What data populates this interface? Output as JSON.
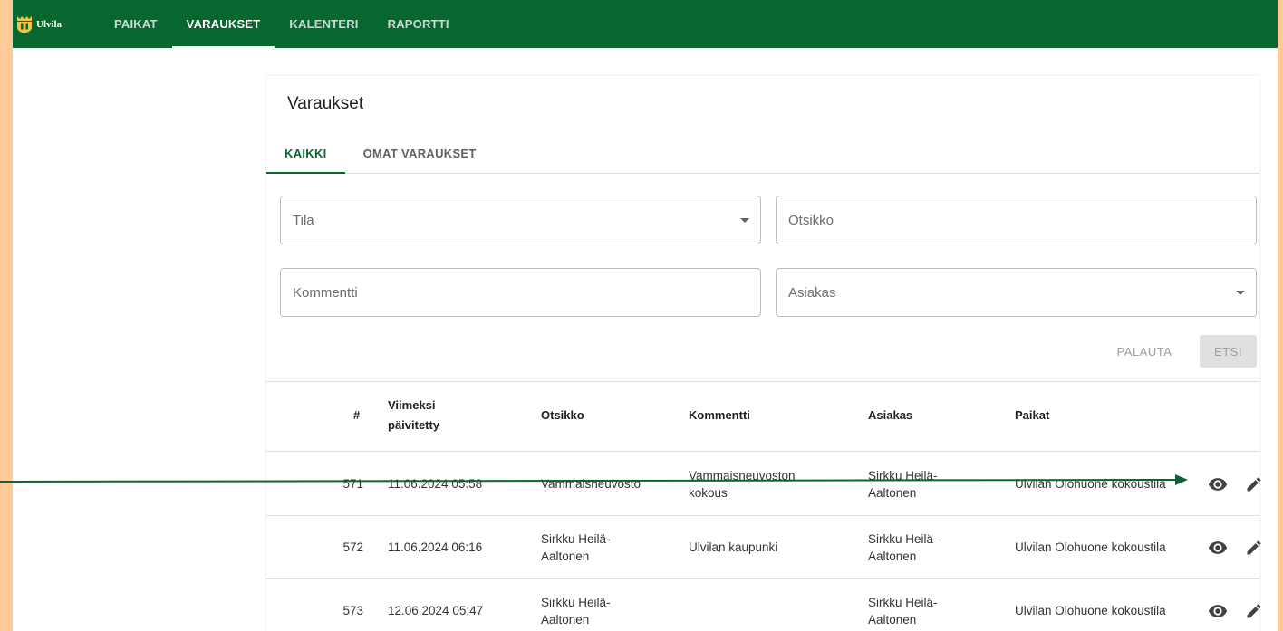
{
  "app": {
    "brand": "Ulvila"
  },
  "nav": [
    {
      "label": "PAIKAT",
      "active": false
    },
    {
      "label": "VARAUKSET",
      "active": true
    },
    {
      "label": "KALENTERI",
      "active": false
    },
    {
      "label": "RAPORTTI",
      "active": false
    }
  ],
  "page": {
    "title": "Varaukset"
  },
  "tabs": [
    {
      "label": "KAIKKI",
      "active": true
    },
    {
      "label": "OMAT VARAUKSET",
      "active": false
    }
  ],
  "filters": {
    "tila": {
      "placeholder": "Tila"
    },
    "otsikko": {
      "placeholder": "Otsikko"
    },
    "kommentti": {
      "placeholder": "Kommentti"
    },
    "asiakas": {
      "placeholder": "Asiakas"
    }
  },
  "actions": {
    "reset": "PALAUTA",
    "search": "ETSI"
  },
  "table": {
    "headers": {
      "id": "#",
      "updated_line1": "Viimeksi",
      "updated_line2": "päivitetty",
      "title": "Otsikko",
      "comment": "Kommentti",
      "customer": "Asiakas",
      "places": "Paikat"
    },
    "rows": [
      {
        "id": "571",
        "updated": "11.06.2024 05:58",
        "title_line1": "Vammaisneuvosto",
        "title_line2": "",
        "comment_line1": "Vammaisneuvoston",
        "comment_line2": "kokous",
        "customer_line1": "Sirkku Heilä-",
        "customer_line2": "Aaltonen",
        "places": "Ulvilan Olohuone kokoustila"
      },
      {
        "id": "572",
        "updated": "11.06.2024 06:16",
        "title_line1": "Sirkku Heilä-",
        "title_line2": "Aaltonen",
        "comment_line1": "Ulvilan kaupunki",
        "comment_line2": "",
        "customer_line1": "Sirkku Heilä-",
        "customer_line2": "Aaltonen",
        "places": "Ulvilan Olohuone kokoustila"
      },
      {
        "id": "573",
        "updated": "12.06.2024 05:47",
        "title_line1": "Sirkku Heilä-",
        "title_line2": "Aaltonen",
        "comment_line1": "",
        "comment_line2": "",
        "customer_line1": "Sirkku Heilä-",
        "customer_line2": "Aaltonen",
        "places": "Ulvilan Olohuone kokoustila"
      }
    ]
  },
  "icons": {
    "view": "eye-icon",
    "edit": "pencil-icon"
  },
  "colors": {
    "brand": "#07672f",
    "background": "#ffcc99"
  }
}
